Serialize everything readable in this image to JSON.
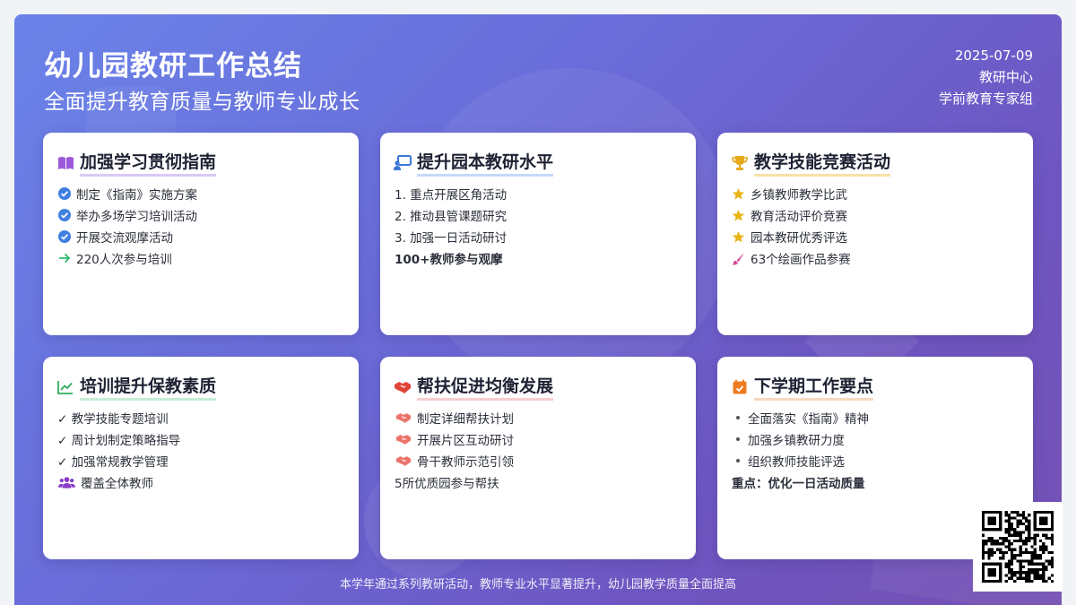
{
  "header": {
    "title": "幼儿园教研工作总结",
    "subtitle": "全面提升教育质量与教师专业成长",
    "date": "2025-07-09",
    "org": "教研中心",
    "team": "学前教育专家组"
  },
  "cards": [
    {
      "title": "加强学习贯彻指南",
      "icon": "book-icon",
      "items": [
        "制定《指南》实施方案",
        "举办多场学习培训活动",
        "开展交流观摩活动",
        "220人次参与培训"
      ]
    },
    {
      "title": "提升园本教研水平",
      "icon": "teacher-board-icon",
      "items": [
        "1. 重点开展区角活动",
        "2. 推动县管课题研究",
        "3. 加强一日活动研讨",
        "100+教师参与观摩"
      ]
    },
    {
      "title": "教学技能竞赛活动",
      "icon": "trophy-icon",
      "items": [
        "乡镇教师教学比武",
        "教育活动评价竞赛",
        "园本教研优秀评选",
        "63个绘画作品参赛"
      ]
    },
    {
      "title": "培训提升保教素质",
      "icon": "chart-line-icon",
      "items": [
        "✓ 教学技能专题培训",
        "✓ 周计划制定策略指导",
        "✓ 加强常规教学管理",
        "覆盖全体教师"
      ]
    },
    {
      "title": "帮扶促进均衡发展",
      "icon": "handshake-icon",
      "items": [
        "制定详细帮扶计划",
        "开展片区互动研讨",
        "骨干教师示范引领",
        "5所优质园参与帮扶"
      ]
    },
    {
      "title": "下学期工作要点",
      "icon": "calendar-icon",
      "items": [
        "全面落实《指南》精神",
        "加强乡镇教研力度",
        "组织教师技能评选",
        "重点：优化一日活动质量"
      ]
    }
  ],
  "footer": {
    "text": "本学年通过系列教研活动，教师专业水平显著提升，幼儿园教学质量全面提高"
  },
  "colors": {
    "bg_start": "#6a83e8",
    "bg_end": "#7451b3",
    "accent_blue": "#4757c9",
    "accent_pink": "#d24a94",
    "accent_purple": "#8a3cc8",
    "accent_sky": "#3b8ad8"
  }
}
